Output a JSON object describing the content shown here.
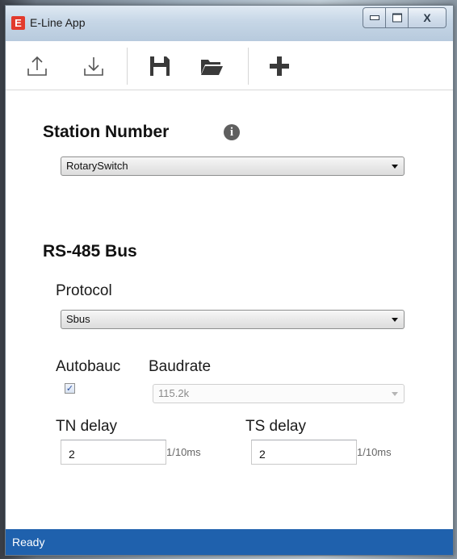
{
  "window": {
    "app_icon_letter": "E",
    "title": "E-Line App",
    "caption": {
      "close_glyph": "X"
    }
  },
  "toolbar": {
    "items": [
      {
        "name": "upload-icon"
      },
      {
        "name": "download-icon"
      },
      {
        "name": "save-icon"
      },
      {
        "name": "open-folder-icon"
      },
      {
        "name": "add-icon"
      }
    ]
  },
  "station": {
    "heading": "Station Number",
    "info_glyph": "i",
    "select_value": "RotarySwitch"
  },
  "rs485": {
    "heading": "RS-485 Bus",
    "protocol_label": "Protocol",
    "protocol_value": "Sbus",
    "autobaud_label": "Autobauc",
    "autobaud_checked": true,
    "check_glyph": "✓",
    "baudrate_label": "Baudrate",
    "baudrate_value": "115.2k",
    "tn_delay_label": "TN delay",
    "tn_delay_value": "2",
    "tn_delay_unit": "1/10ms",
    "ts_delay_label": "TS delay",
    "ts_delay_value": "2",
    "ts_delay_unit": "1/10ms"
  },
  "status": {
    "text": "Ready"
  },
  "colors": {
    "accent": "#1f61ad",
    "app_icon": "#e23a2c"
  }
}
